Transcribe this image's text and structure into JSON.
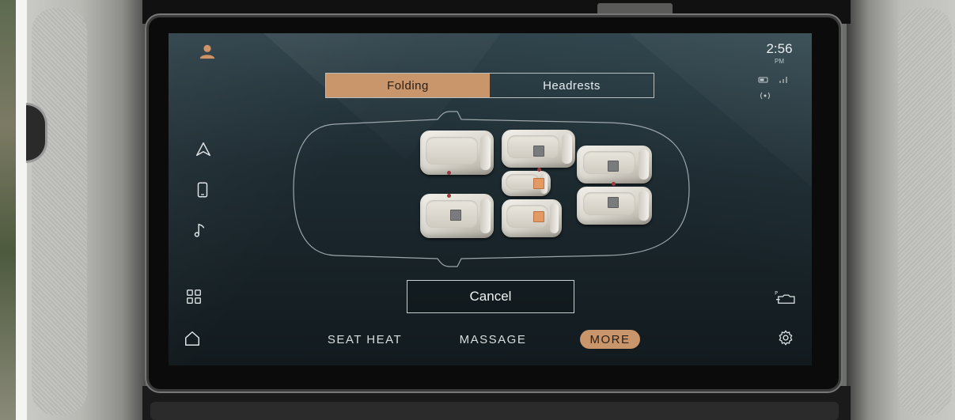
{
  "status": {
    "time": "2:56",
    "ampm": "PM"
  },
  "tabs": [
    {
      "label": "Folding",
      "active": true
    },
    {
      "label": "Headrests",
      "active": false
    }
  ],
  "actions": {
    "cancel_label": "Cancel"
  },
  "bottom_nav": [
    {
      "label": "SEAT HEAT",
      "active": false
    },
    {
      "label": "MASSAGE",
      "active": false
    },
    {
      "label": "MORE",
      "active": true
    }
  ],
  "rail_icons": [
    "profile-icon",
    "navigation-icon",
    "phone-icon",
    "music-icon",
    "apps-grid-icon",
    "home-icon"
  ],
  "right_icons": [
    "parking-camera-icon",
    "settings-gear-icon"
  ],
  "seats": [
    {
      "id": "driver",
      "marker": "none"
    },
    {
      "id": "front-passenger",
      "marker": "grey"
    },
    {
      "id": "row2-left",
      "marker": "grey"
    },
    {
      "id": "row2-center-front",
      "marker": "orange"
    },
    {
      "id": "row2-center-rear",
      "marker": "orange"
    },
    {
      "id": "row2-right",
      "marker": "grey"
    },
    {
      "id": "row3-left",
      "marker": "grey"
    },
    {
      "id": "row3-right",
      "marker": "grey"
    }
  ],
  "colors": {
    "accent": "#c9956a",
    "screen_bg": "#1d2b31",
    "marker_grey": "#7a7b7c",
    "marker_orange": "#e39a62"
  }
}
